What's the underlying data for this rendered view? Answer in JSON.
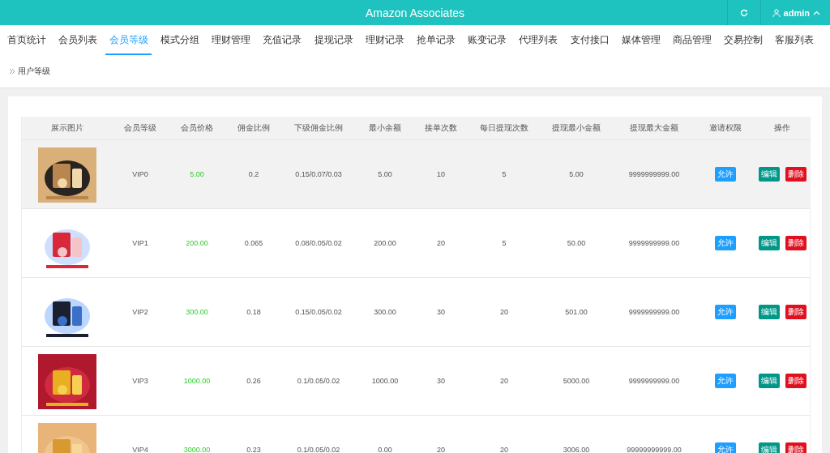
{
  "header": {
    "title": "Amazon Associates",
    "user": "admin"
  },
  "tabs": [
    {
      "label": "首页统计",
      "selected": false
    },
    {
      "label": "会员列表",
      "selected": false
    },
    {
      "label": "会员等级",
      "selected": true
    },
    {
      "label": "模式分组",
      "selected": false
    },
    {
      "label": "理财管理",
      "selected": false
    },
    {
      "label": "充值记录",
      "selected": false
    },
    {
      "label": "提现记录",
      "selected": false
    },
    {
      "label": "理财记录",
      "selected": false
    },
    {
      "label": "抢单记录",
      "selected": false
    },
    {
      "label": "账变记录",
      "selected": false
    },
    {
      "label": "代理列表",
      "selected": false
    },
    {
      "label": "支付接口",
      "selected": false
    },
    {
      "label": "媒体管理",
      "selected": false
    },
    {
      "label": "商品管理",
      "selected": false
    },
    {
      "label": "交易控制",
      "selected": false
    },
    {
      "label": "客服列表",
      "selected": false
    }
  ],
  "breadcrumb": "用户等级",
  "table": {
    "columns": [
      "展示图片",
      "会员等级",
      "会员价格",
      "佣金比例",
      "下级佣金比例",
      "最小余额",
      "接单次数",
      "每日提现次数",
      "提现最小金额",
      "提现最大金额",
      "邀请权限",
      "操作"
    ],
    "rows": [
      {
        "hovered": true,
        "level": "VIP0",
        "price": "5.00",
        "commission": "0.2",
        "sub_commission": "0.15/0.07/0.03",
        "min_balance": "5.00",
        "orders": "10",
        "daily_withdrawals": "5",
        "withdraw_min": "5.00",
        "withdraw_max": "9999999999.00",
        "invite": "允许",
        "actions": [
          "编辑",
          "删除"
        ]
      },
      {
        "hovered": false,
        "level": "VIP1",
        "price": "200.00",
        "commission": "0.065",
        "sub_commission": "0.08/0.05/0.02",
        "min_balance": "200.00",
        "orders": "20",
        "daily_withdrawals": "5",
        "withdraw_min": "50.00",
        "withdraw_max": "9999999999.00",
        "invite": "允许",
        "actions": [
          "编辑",
          "删除"
        ]
      },
      {
        "hovered": false,
        "level": "VIP2",
        "price": "300.00",
        "commission": "0.18",
        "sub_commission": "0.15/0.05/0.02",
        "min_balance": "300.00",
        "orders": "30",
        "daily_withdrawals": "20",
        "withdraw_min": "501.00",
        "withdraw_max": "9999999999.00",
        "invite": "允许",
        "actions": [
          "编辑",
          "删除"
        ]
      },
      {
        "hovered": false,
        "level": "VIP3",
        "price": "1000.00",
        "commission": "0.26",
        "sub_commission": "0.1/0.05/0.02",
        "min_balance": "1000.00",
        "orders": "30",
        "daily_withdrawals": "20",
        "withdraw_min": "5000.00",
        "withdraw_max": "9999999999.00",
        "invite": "允许",
        "actions": [
          "编辑",
          "删除"
        ]
      },
      {
        "hovered": false,
        "level": "VIP4",
        "price": "3000.00",
        "commission": "0.23",
        "sub_commission": "0.1/0.05/0.02",
        "min_balance": "0.00",
        "orders": "20",
        "daily_withdrawals": "20",
        "withdraw_min": "3006.00",
        "withdraw_max": "99999999999.00",
        "invite": "允许",
        "actions": [
          "编辑",
          "删除"
        ]
      }
    ]
  }
}
